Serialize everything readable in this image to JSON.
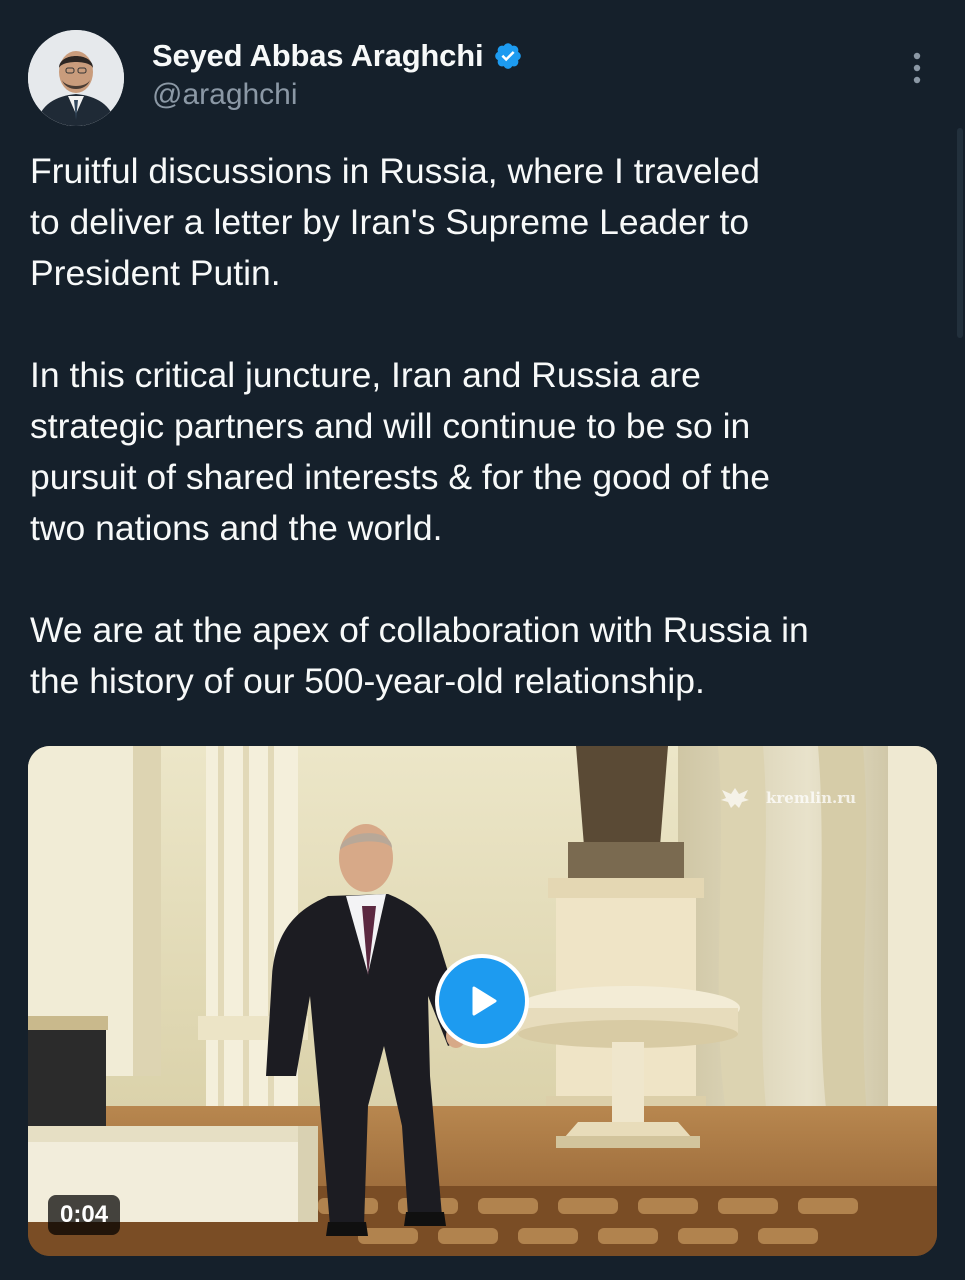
{
  "tweet": {
    "author": {
      "display_name": "Seyed Abbas Araghchi",
      "handle": "@araghchi",
      "verified": true,
      "verified_icon": "verified-badge-icon",
      "avatar": "profile-photo"
    },
    "more_icon": "more-vertical-icon",
    "paragraphs": [
      "Fruitful discussions in Russia, where I traveled\nto deliver a letter by Iran's Supreme Leader to\nPresident Putin.",
      "In this critical juncture, Iran and Russia are\nstrategic partners and will continue to be so in\npursuit of shared interests & for the good of the\ntwo nations and the world.",
      "We are at the apex of collaboration with Russia in\nthe history of our 500-year-old relationship."
    ],
    "media": {
      "type": "video",
      "duration": "0:04",
      "watermark": "kremlin.ru",
      "play_icon": "play-icon"
    }
  },
  "colors": {
    "background": "#15202b",
    "text": "#f7f9f9",
    "secondary_text": "#8b98a5",
    "accent": "#1d9bf0"
  }
}
